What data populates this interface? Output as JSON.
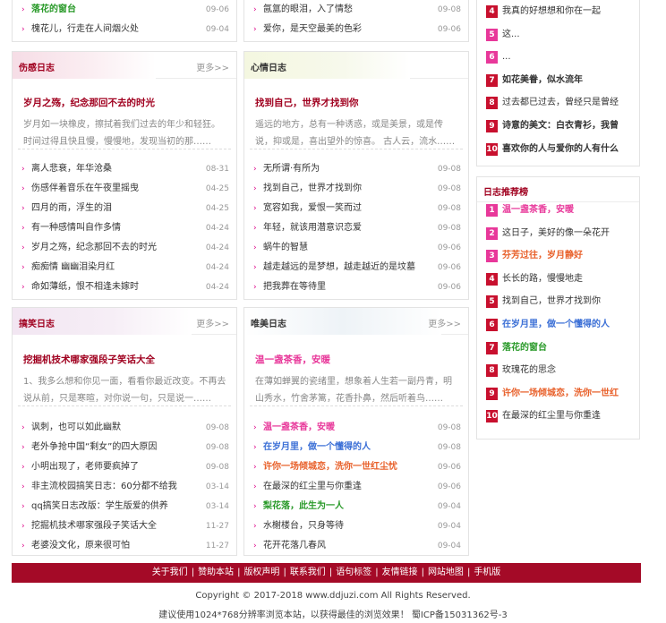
{
  "top_left": {
    "rows": [
      {
        "title": "落花的窗台",
        "date": "09-06",
        "highlight": true
      },
      {
        "title": "槐花儿，行走在人间烟火处",
        "date": "09-04",
        "highlight": false
      }
    ]
  },
  "top_middle": {
    "rows": [
      {
        "title": "氤氲的眼泪，入了情愁",
        "date": "09-08"
      },
      {
        "title": "爱你，是天空最美的色彩",
        "date": "09-06"
      }
    ]
  },
  "top_rank": {
    "rows": [
      {
        "num": "4",
        "title": "我真的好想想和你在一起"
      },
      {
        "num": "5",
        "title": "这..."
      },
      {
        "num": "6",
        "title": "..."
      },
      {
        "num": "7",
        "title": "如花美眷，似水流年"
      },
      {
        "num": "8",
        "title": "过去都已过去，曾经只是曾经"
      },
      {
        "num": "9",
        "title": "诗意的美文：白衣青衫，我曾"
      },
      {
        "num": "10",
        "title": "喜欢你的人与爱你的人有什么"
      }
    ]
  },
  "sad": {
    "title": "伤感日志",
    "more": "更多>>",
    "feature_title": "岁月之殇，纪念那回不去的时光",
    "feature_desc": "岁月如一块橡皮，擦拭着我们过去的年少和轻狂。时间过得且快且慢，慢慢地，发现当初的那……",
    "rows": [
      {
        "title": "离人悲衰，年华沧桑",
        "date": "08-31"
      },
      {
        "title": "伤感伴着音乐在午夜里摇曳",
        "date": "04-25"
      },
      {
        "title": "四月的雨，浮生的泪",
        "date": "04-25"
      },
      {
        "title": "有一种感情叫自作多情",
        "date": "04-24"
      },
      {
        "title": "岁月之殇，纪念那回不去的时光",
        "date": "04-24"
      },
      {
        "title": "痴痴情 幽幽泪染月红",
        "date": "04-24"
      },
      {
        "title": "命如薄纸，恨不相逢未嫁时",
        "date": "04-24"
      }
    ]
  },
  "mood": {
    "title": "心情日志",
    "feature_title": "找到自己，世界才找到你",
    "feature_desc": "遥远的地方，总有一种诱惑，或是美景，或是传说，抑或是，喜出望外的惊喜。 古人云，流水……",
    "rows": [
      {
        "title": "无所谓·有所为",
        "date": "09-08"
      },
      {
        "title": "找到自己，世界才找到你",
        "date": "09-08"
      },
      {
        "title": "宽容如我，爱恨一笑而过",
        "date": "09-08"
      },
      {
        "title": "年轻，就该用潜意识恋爱",
        "date": "09-08"
      },
      {
        "title": "蜗牛的智慧",
        "date": "09-06"
      },
      {
        "title": "越走越远的是梦想，越走越近的是坟墓",
        "date": "09-06"
      },
      {
        "title": "把我葬在等待里",
        "date": "09-06"
      }
    ]
  },
  "funny": {
    "title": "搞笑日志",
    "more": "更多>>",
    "feature_title": "挖掘机技术哪家强段子笑话大全",
    "feature_desc": "1、我多么想和你见一面，看看你最近改变。不再去说从前，只是寒暄，对你说一句，只是说一……",
    "rows": [
      {
        "title": "讽刺，也可以如此幽默",
        "date": "09-08"
      },
      {
        "title": "老外争抢中国“剩女”的四大原因",
        "date": "09-08"
      },
      {
        "title": "小明出现了，老师要疯掉了",
        "date": "09-08"
      },
      {
        "title": "非主流校园搞笑日志：60分都不给我",
        "date": "03-14"
      },
      {
        "title": "qq搞笑日志改版：学生版爱的供养",
        "date": "03-14"
      },
      {
        "title": "挖掘机技术哪家强段子笑话大全",
        "date": "11-27"
      },
      {
        "title": "老婆没文化，原来很可怕",
        "date": "11-27"
      }
    ]
  },
  "beauty": {
    "title": "唯美日志",
    "more": "更多>>",
    "feature_title": "温一盏茶香，安暖",
    "feature_desc": "在薄如蝉翼的瓷绪里，想象着人生若一副丹青，明山秀水，竹舍茅篱，花香扑鼻，然后听着鸟……",
    "rows": [
      {
        "title": "温一盏茶香，安暖",
        "date": "09-08",
        "color": "#e8389a"
      },
      {
        "title": "在岁月里，做一个懂得的人",
        "date": "09-08",
        "color": "#3b6fd6"
      },
      {
        "title": "许你一场倾城恋，洗你一世红尘忧",
        "date": "09-06",
        "color": "#e8602a"
      },
      {
        "title": "在最深的红尘里与你重逢",
        "date": "09-06",
        "color": ""
      },
      {
        "title": "梨花落，此生为一人",
        "date": "09-04",
        "color": "#2a9a2a"
      },
      {
        "title": "水榭楼台，只身等待",
        "date": "09-04",
        "color": ""
      },
      {
        "title": "花开花落几春风",
        "date": "09-04",
        "color": ""
      }
    ]
  },
  "recommend": {
    "title": "日志推荐榜",
    "rows": [
      {
        "num": "1",
        "title": "温一盏茶香，安暖",
        "color": "#e8389a",
        "num_bg": "#e8389a"
      },
      {
        "num": "2",
        "title": "这日子，美好的像一朵花开",
        "color": "",
        "num_bg": "#e8389a"
      },
      {
        "num": "3",
        "title": "芬芳过往，岁月静好",
        "color": "#e8602a",
        "num_bg": "#e8389a"
      },
      {
        "num": "4",
        "title": "长长的路，慢慢地走",
        "color": "",
        "num_bg": "#c8102e"
      },
      {
        "num": "5",
        "title": "找到自己，世界才找到你",
        "color": "",
        "num_bg": "#c8102e"
      },
      {
        "num": "6",
        "title": "在岁月里，做一个懂得的人",
        "color": "#3b6fd6",
        "num_bg": "#c8102e"
      },
      {
        "num": "7",
        "title": "落花的窗台",
        "color": "#2a9a2a",
        "num_bg": "#c8102e"
      },
      {
        "num": "8",
        "title": "玫瑰花的思念",
        "color": "",
        "num_bg": "#c8102e"
      },
      {
        "num": "9",
        "title": "许你一场倾城恋，洗你一世红",
        "color": "#e8602a",
        "num_bg": "#c8102e"
      },
      {
        "num": "10",
        "title": "在最深的红尘里与你重逢",
        "color": "",
        "num_bg": "#c8102e"
      }
    ]
  },
  "footer": {
    "links": [
      "关于我们",
      "赞助本站",
      "版权声明",
      "联系我们",
      "语句标签",
      "友情链接",
      "网站地图",
      "手机版"
    ],
    "copyright": "Copyright © 2017-2018 www.ddjuzi.com All Rights Reserved.",
    "notice": "建议使用1024*768分辨率浏览本站，以获得最佳的浏览效果！ 蜀ICP备15031362号-3"
  },
  "colors": {
    "brand": "#a40a27",
    "accent_title": "#a0001f",
    "date": "#999999"
  }
}
